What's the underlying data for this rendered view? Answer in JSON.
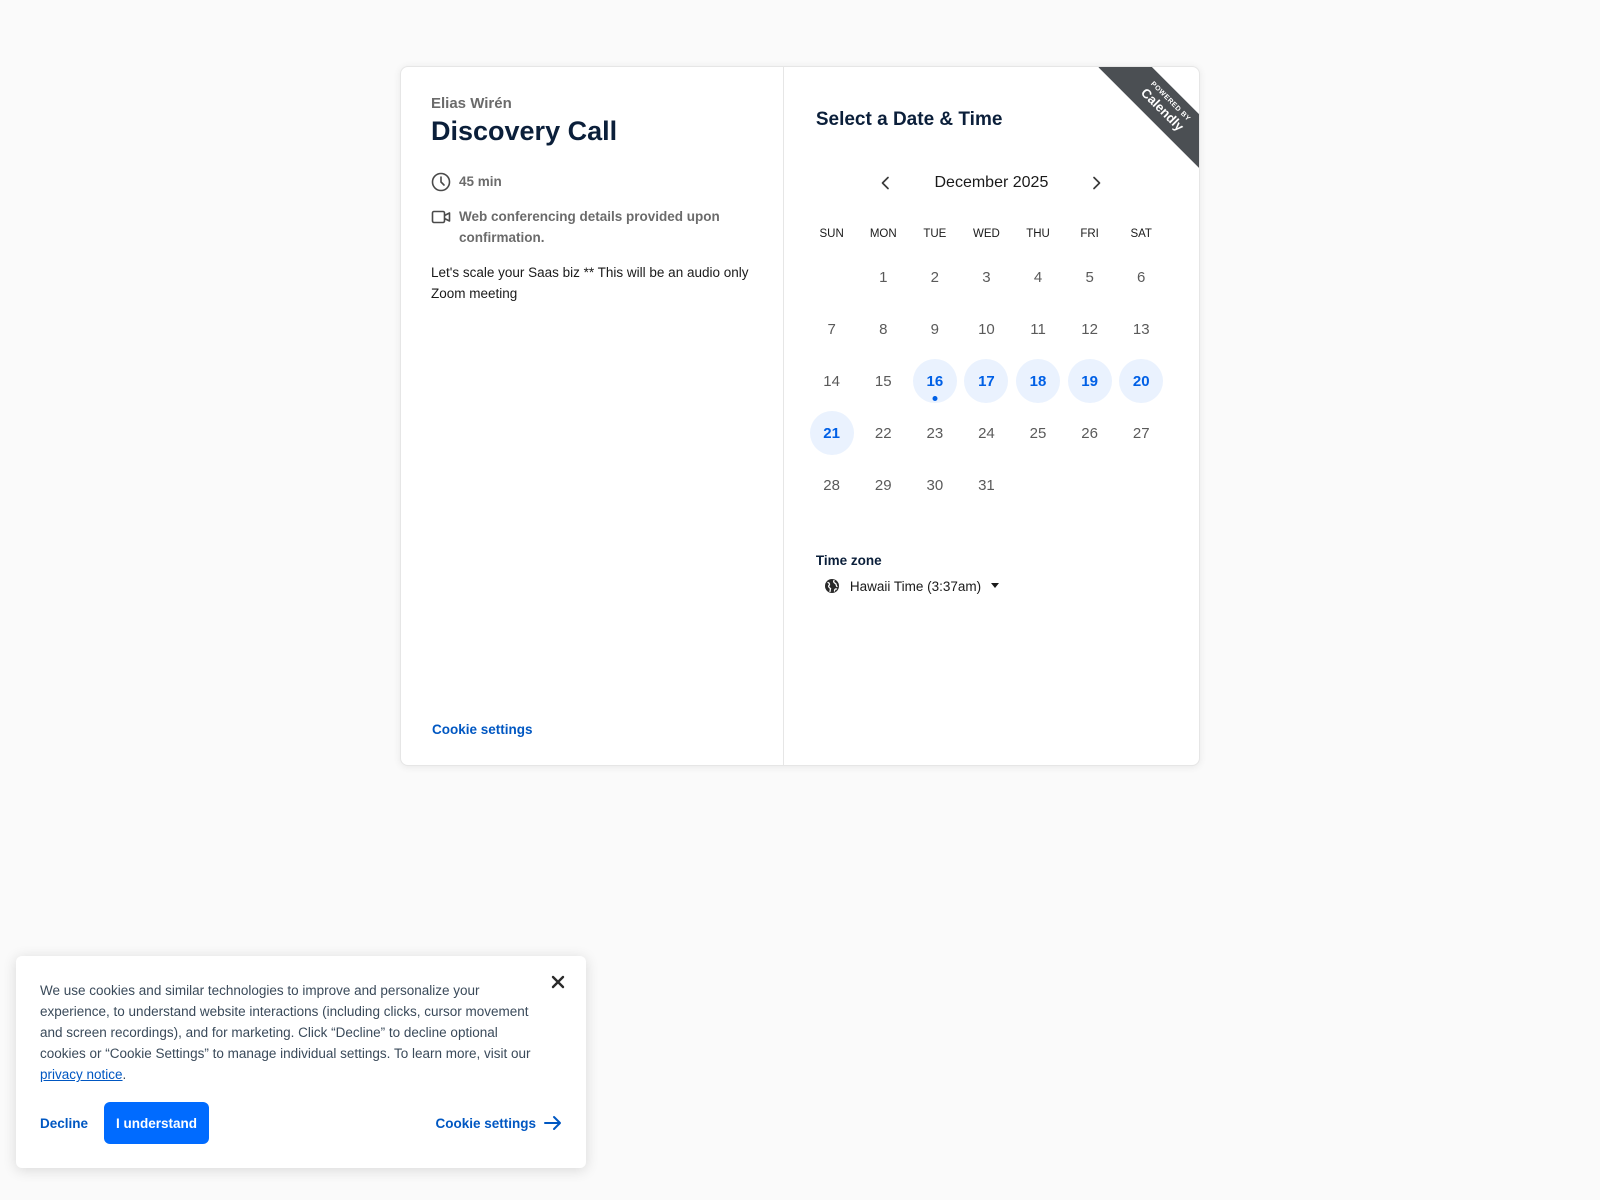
{
  "event": {
    "host": "Elias Wirén",
    "title": "Discovery Call",
    "duration": "45 min",
    "conferencing": "Web conferencing details provided upon confirmation.",
    "description": "Let's scale your Saas biz ** This will be an audio only Zoom meeting",
    "cookie_settings_label": "Cookie settings"
  },
  "scheduler": {
    "title": "Select a Date & Time",
    "month_label": "December 2025",
    "weekdays": [
      "SUN",
      "MON",
      "TUE",
      "WED",
      "THU",
      "FRI",
      "SAT"
    ],
    "weeks": [
      [
        "",
        "1",
        "2",
        "3",
        "4",
        "5",
        "6"
      ],
      [
        "7",
        "8",
        "9",
        "10",
        "11",
        "12",
        "13"
      ],
      [
        "14",
        "15",
        "16",
        "17",
        "18",
        "19",
        "20"
      ],
      [
        "21",
        "22",
        "23",
        "24",
        "25",
        "26",
        "27"
      ],
      [
        "28",
        "29",
        "30",
        "31",
        "",
        "",
        ""
      ]
    ],
    "available_days": [
      "16",
      "17",
      "18",
      "19",
      "20",
      "21"
    ],
    "today": "16",
    "timezone_label": "Time zone",
    "timezone_value": "Hawaii Time (3:37am)"
  },
  "badge": {
    "small": "POWERED BY",
    "large": "Calendly"
  },
  "cookie_banner": {
    "text": "We use cookies and similar technologies to improve and personalize your experience, to understand website interactions (including clicks, cursor movement and screen recordings), and for marketing. Click “Decline” to decline optional cookies or “Cookie Settings” to manage individual settings. To learn more, visit our ",
    "privacy_link": "privacy notice",
    "text_end": ".",
    "decline_label": "Decline",
    "understand_label": "I understand",
    "settings_label": "Cookie settings"
  },
  "colors": {
    "accent": "#006bff",
    "link": "#0057c2",
    "available_bg": "#eaf2fe",
    "heading": "#0b1f3a"
  }
}
